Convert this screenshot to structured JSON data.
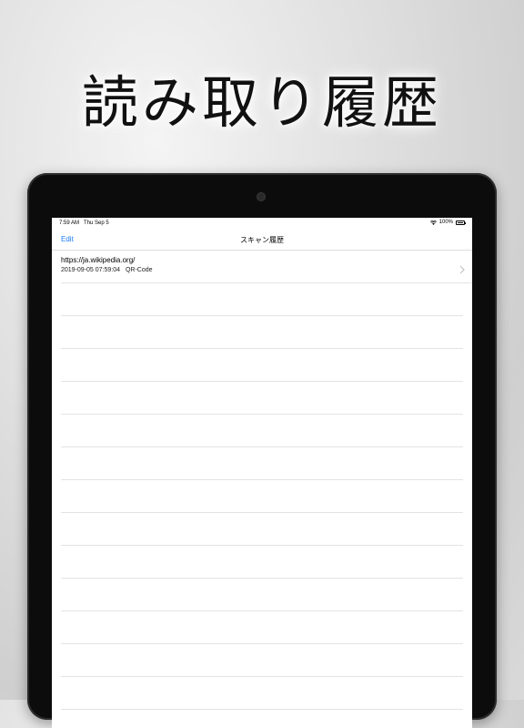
{
  "headline": "読み取り履歴",
  "status_bar": {
    "time": "7:59 AM",
    "date": "Thu Sep 5",
    "battery": "100%",
    "icons": [
      "wifi-icon",
      "battery-icon"
    ]
  },
  "nav": {
    "edit_label": "Edit",
    "title": "スキャン履歴"
  },
  "history": [
    {
      "url": "https://ja.wikipedia.org/",
      "timestamp": "2019-09-05 07:59:04",
      "type": "QR-Code"
    }
  ],
  "colors": {
    "accent": "#1a7cf5",
    "device_bezel": "#0c0c0c"
  }
}
